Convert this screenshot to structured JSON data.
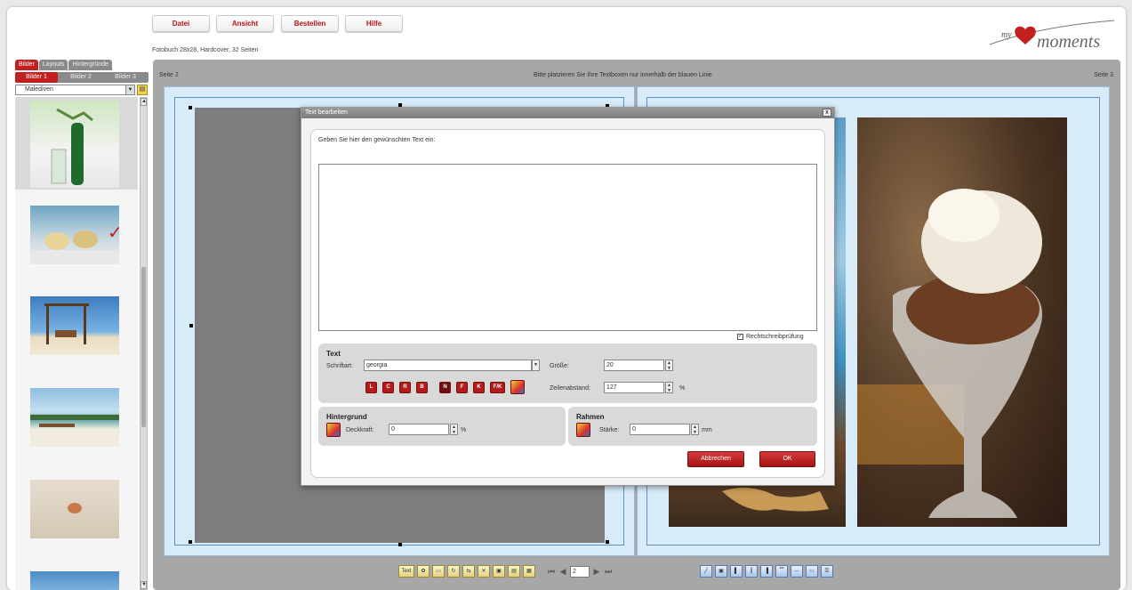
{
  "menu": {
    "datei": "Datei",
    "ansicht": "Ansicht",
    "bestellen": "Bestellen",
    "hilfe": "Hilfe"
  },
  "subtitle": "Fotobuch 28x28, Hardcover, 32 Seiten",
  "logo": {
    "my": "my",
    "moments": "moments"
  },
  "left_panel": {
    "tabs": [
      "Bilder",
      "Layouts",
      "Hintergründe"
    ],
    "subtabs": [
      "Bilder 1",
      "Bilder 2",
      "Bilder 3"
    ],
    "album": "Malediven",
    "used_mark": "✓"
  },
  "workspace": {
    "left_page": "Seite 2",
    "right_page": "Seite 3",
    "hint": "Bitte platzieren Sie Ihre Textboxen nur innerhalb der blauen Linie."
  },
  "dialog": {
    "title": "Text bearbeiten",
    "close": "x",
    "prompt": "Geben Sie hier den gewünschten Text ein:",
    "text_value": "",
    "spellcheck_label": "Rechtschreibprüfung",
    "spellcheck_checked": true,
    "text_section": {
      "title": "Text",
      "font_label": "Schriftart:",
      "font_value": "georgia",
      "size_label": "Größe:",
      "size_value": "20",
      "line_spacing_label": "Zeilenabstand:",
      "line_spacing_value": "127",
      "line_spacing_unit": "%",
      "format_buttons": [
        "L",
        "C",
        "R",
        "B",
        "N",
        "F",
        "K",
        "F/K"
      ]
    },
    "background_section": {
      "title": "Hintergrund",
      "opacity_label": "Deckkraft:",
      "opacity_value": "0",
      "unit": "%"
    },
    "frame_section": {
      "title": "Rahmen",
      "strength_label": "Stärke:",
      "strength_value": "0",
      "unit": "mm"
    },
    "cancel": "Abbrechen",
    "ok": "OK"
  },
  "toolbar": {
    "text_btn": "Text",
    "page_value": "2"
  },
  "colors": {
    "accent": "#b41c1c",
    "workspace": "#a7a7a7",
    "page_bg": "#d7ebf8",
    "guide_line": "#5b90c9"
  }
}
